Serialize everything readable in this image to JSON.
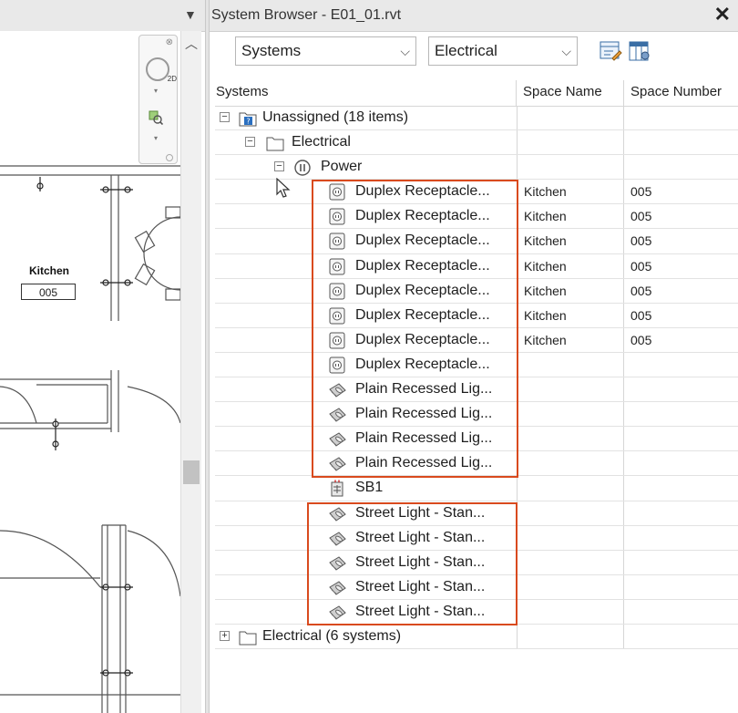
{
  "canvas": {
    "room_name": "Kitchen",
    "room_number": "005"
  },
  "panel": {
    "title": "System Browser - E01_01.rvt",
    "close_icon": "close-icon",
    "view_select": {
      "selected": "Systems"
    },
    "discipline_select": {
      "selected": "Electrical"
    },
    "toolbar": {
      "config_icon": "system-config-icon",
      "columns_icon": "column-settings-icon"
    }
  },
  "grid": {
    "columns": [
      "Systems",
      "Space Name",
      "Space Number"
    ],
    "tree": {
      "unassigned": "Unassigned (18 items)",
      "electrical": "Electrical",
      "power": "Power",
      "electrical_systems": "Electrical (6 systems)"
    },
    "rows": [
      {
        "label": "Duplex Receptacle...",
        "icon": "receptacle-icon",
        "space_name": "Kitchen",
        "space_number": "005"
      },
      {
        "label": "Duplex Receptacle...",
        "icon": "receptacle-icon",
        "space_name": "Kitchen",
        "space_number": "005"
      },
      {
        "label": "Duplex Receptacle...",
        "icon": "receptacle-icon",
        "space_name": "Kitchen",
        "space_number": "005"
      },
      {
        "label": "Duplex Receptacle...",
        "icon": "receptacle-icon",
        "space_name": "Kitchen",
        "space_number": "005"
      },
      {
        "label": "Duplex Receptacle...",
        "icon": "receptacle-icon",
        "space_name": "Kitchen",
        "space_number": "005"
      },
      {
        "label": "Duplex Receptacle...",
        "icon": "receptacle-icon",
        "space_name": "Kitchen",
        "space_number": "005"
      },
      {
        "label": "Duplex Receptacle...",
        "icon": "receptacle-icon",
        "space_name": "Kitchen",
        "space_number": "005"
      },
      {
        "label": "Duplex Receptacle...",
        "icon": "receptacle-icon",
        "space_name": "",
        "space_number": ""
      },
      {
        "label": "Plain Recessed Lig...",
        "icon": "light-fixture-icon",
        "space_name": "",
        "space_number": ""
      },
      {
        "label": "Plain Recessed Lig...",
        "icon": "light-fixture-icon",
        "space_name": "",
        "space_number": ""
      },
      {
        "label": "Plain Recessed Lig...",
        "icon": "light-fixture-icon",
        "space_name": "",
        "space_number": ""
      },
      {
        "label": "Plain Recessed Lig...",
        "icon": "light-fixture-icon",
        "space_name": "",
        "space_number": ""
      },
      {
        "label": "SB1",
        "icon": "panel-board-icon",
        "space_name": "",
        "space_number": ""
      },
      {
        "label": "Street Light - Stan...",
        "icon": "light-fixture-icon",
        "space_name": "",
        "space_number": ""
      },
      {
        "label": "Street Light - Stan...",
        "icon": "light-fixture-icon",
        "space_name": "",
        "space_number": ""
      },
      {
        "label": "Street Light - Stan...",
        "icon": "light-fixture-icon",
        "space_name": "",
        "space_number": ""
      },
      {
        "label": "Street Light - Stan...",
        "icon": "light-fixture-icon",
        "space_name": "",
        "space_number": ""
      },
      {
        "label": "Street Light - Stan...",
        "icon": "light-fixture-icon",
        "space_name": "",
        "space_number": ""
      }
    ]
  },
  "colors": {
    "highlight": "#d94a1e"
  }
}
